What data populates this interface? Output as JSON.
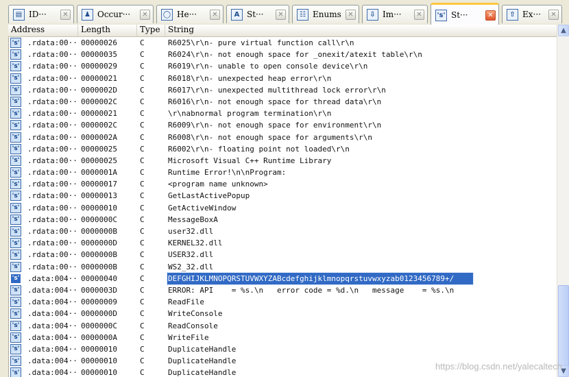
{
  "tabs": [
    {
      "label": "ID···",
      "icon": "ida-view-icon",
      "glyph": "▤"
    },
    {
      "label": "Occur···",
      "icon": "occurrences-icon",
      "glyph": "♟"
    },
    {
      "label": "He···",
      "icon": "hex-view-icon",
      "glyph": "◯"
    },
    {
      "label": "St···",
      "icon": "structures-icon",
      "glyph": "A"
    },
    {
      "label": "Enums",
      "icon": "enums-icon",
      "glyph": "☷"
    },
    {
      "label": "Im···",
      "icon": "imports-icon",
      "glyph": "⇩"
    },
    {
      "label": "St···",
      "icon": "strings-icon",
      "glyph": "'s'"
    },
    {
      "label": "Ex···",
      "icon": "exports-icon",
      "glyph": "⇧"
    }
  ],
  "active_tab": 6,
  "columns": {
    "address": "Address",
    "length": "Length",
    "type": "Type",
    "string": "String"
  },
  "rows": [
    {
      "address": ".rdata:00···",
      "length": "00000026",
      "type": "C",
      "string": "R6025\\r\\n- pure virtual function call\\r\\n"
    },
    {
      "address": ".rdata:00···",
      "length": "00000035",
      "type": "C",
      "string": "R6024\\r\\n- not enough space for _onexit/atexit table\\r\\n"
    },
    {
      "address": ".rdata:00···",
      "length": "00000029",
      "type": "C",
      "string": "R6019\\r\\n- unable to open console device\\r\\n"
    },
    {
      "address": ".rdata:00···",
      "length": "00000021",
      "type": "C",
      "string": "R6018\\r\\n- unexpected heap error\\r\\n"
    },
    {
      "address": ".rdata:00···",
      "length": "0000002D",
      "type": "C",
      "string": "R6017\\r\\n- unexpected multithread lock error\\r\\n"
    },
    {
      "address": ".rdata:00···",
      "length": "0000002C",
      "type": "C",
      "string": "R6016\\r\\n- not enough space for thread data\\r\\n"
    },
    {
      "address": ".rdata:00···",
      "length": "00000021",
      "type": "C",
      "string": "\\r\\nabnormal program termination\\r\\n"
    },
    {
      "address": ".rdata:00···",
      "length": "0000002C",
      "type": "C",
      "string": "R6009\\r\\n- not enough space for environment\\r\\n"
    },
    {
      "address": ".rdata:00···",
      "length": "0000002A",
      "type": "C",
      "string": "R6008\\r\\n- not enough space for arguments\\r\\n"
    },
    {
      "address": ".rdata:00···",
      "length": "00000025",
      "type": "C",
      "string": "R6002\\r\\n- floating point not loaded\\r\\n"
    },
    {
      "address": ".rdata:00···",
      "length": "00000025",
      "type": "C",
      "string": "Microsoft Visual C++ Runtime Library"
    },
    {
      "address": ".rdata:00···",
      "length": "0000001A",
      "type": "C",
      "string": "Runtime Error!\\n\\nProgram: "
    },
    {
      "address": ".rdata:00···",
      "length": "00000017",
      "type": "C",
      "string": "<program name unknown>"
    },
    {
      "address": ".rdata:00···",
      "length": "00000013",
      "type": "C",
      "string": "GetLastActivePopup"
    },
    {
      "address": ".rdata:00···",
      "length": "00000010",
      "type": "C",
      "string": "GetActiveWindow"
    },
    {
      "address": ".rdata:00···",
      "length": "0000000C",
      "type": "C",
      "string": "MessageBoxA"
    },
    {
      "address": ".rdata:00···",
      "length": "0000000B",
      "type": "C",
      "string": "user32.dll"
    },
    {
      "address": ".rdata:00···",
      "length": "0000000D",
      "type": "C",
      "string": "KERNEL32.dll"
    },
    {
      "address": ".rdata:00···",
      "length": "0000000B",
      "type": "C",
      "string": "USER32.dll"
    },
    {
      "address": ".rdata:00···",
      "length": "0000000B",
      "type": "C",
      "string": "WS2_32.dll"
    },
    {
      "address": ".data:004···",
      "length": "00000040",
      "type": "C",
      "string": "DEFGHIJKLMNOPQRSTUVWXYZABcdefghijklmnopqrstuvwxyzab0123456789+/",
      "selected": true
    },
    {
      "address": ".data:004···",
      "length": "0000003D",
      "type": "C",
      "string": "ERROR: API    = %s.\\n   error code = %d.\\n   message    = %s.\\n"
    },
    {
      "address": ".data:004···",
      "length": "00000009",
      "type": "C",
      "string": "ReadFile"
    },
    {
      "address": ".data:004···",
      "length": "0000000D",
      "type": "C",
      "string": "WriteConsole"
    },
    {
      "address": ".data:004···",
      "length": "0000000C",
      "type": "C",
      "string": "ReadConsole"
    },
    {
      "address": ".data:004···",
      "length": "0000000A",
      "type": "C",
      "string": "WriteFile"
    },
    {
      "address": ".data:004···",
      "length": "00000010",
      "type": "C",
      "string": "DuplicateHandle"
    },
    {
      "address": ".data:004···",
      "length": "00000010",
      "type": "C",
      "string": "DuplicateHandle"
    },
    {
      "address": ".data:004···",
      "length": "00000010",
      "type": "C",
      "string": "DuplicateHandle"
    }
  ],
  "row_icon": "string-icon",
  "row_icon_glyph": "'s'",
  "scrollbar": {
    "up": "▲",
    "down": "▼"
  },
  "watermark": "https://blog.csdn.net/yalecaltech"
}
